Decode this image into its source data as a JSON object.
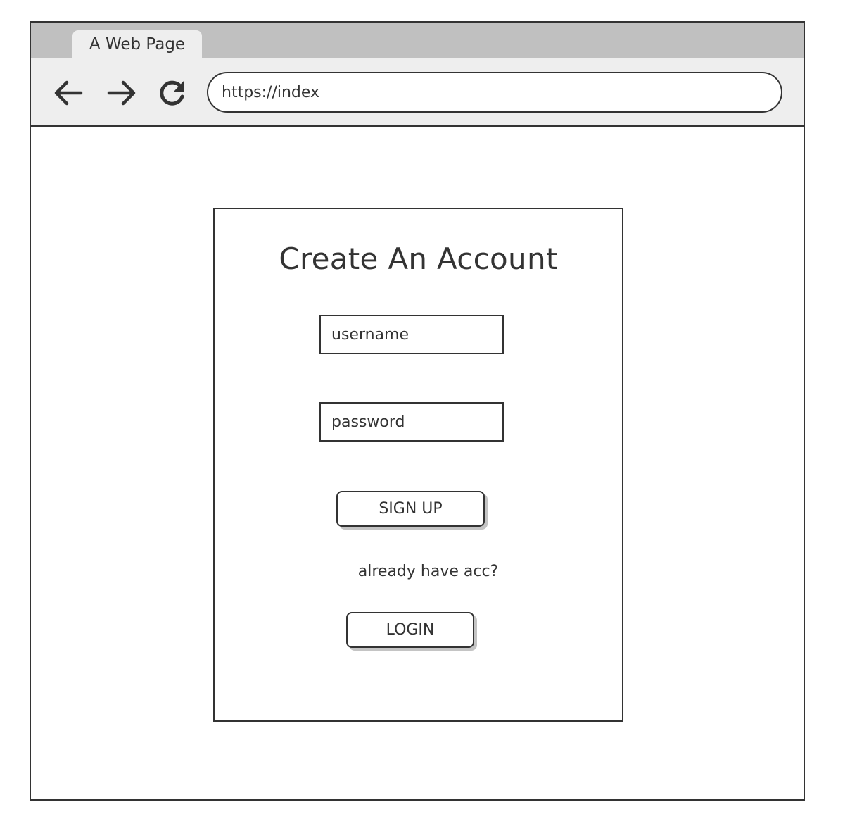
{
  "browser": {
    "tab_title": "A Web Page",
    "url": "https://index",
    "icons": {
      "back": "arrow-left-icon",
      "forward": "arrow-right-icon",
      "reload": "reload-icon"
    }
  },
  "signup_form": {
    "title": "Create An Account",
    "username_value": "username",
    "password_value": "password",
    "signup_button": "SIGN UP",
    "login_prompt": "already have acc?",
    "login_button": "LOGIN"
  }
}
